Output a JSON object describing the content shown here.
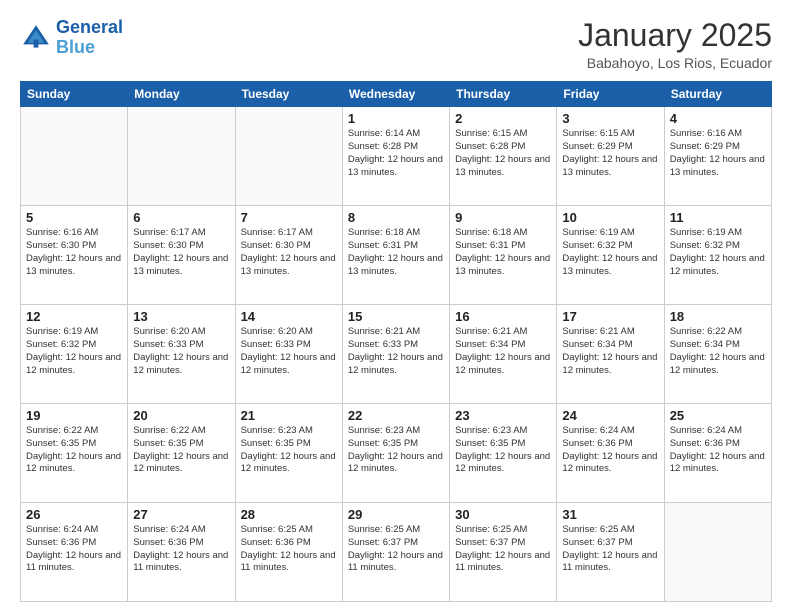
{
  "logo": {
    "line1": "General",
    "line2": "Blue"
  },
  "title": "January 2025",
  "subtitle": "Babahoyo, Los Rios, Ecuador",
  "days_of_week": [
    "Sunday",
    "Monday",
    "Tuesday",
    "Wednesday",
    "Thursday",
    "Friday",
    "Saturday"
  ],
  "weeks": [
    [
      {
        "day": "",
        "info": ""
      },
      {
        "day": "",
        "info": ""
      },
      {
        "day": "",
        "info": ""
      },
      {
        "day": "1",
        "info": "Sunrise: 6:14 AM\nSunset: 6:28 PM\nDaylight: 12 hours and 13 minutes."
      },
      {
        "day": "2",
        "info": "Sunrise: 6:15 AM\nSunset: 6:28 PM\nDaylight: 12 hours and 13 minutes."
      },
      {
        "day": "3",
        "info": "Sunrise: 6:15 AM\nSunset: 6:29 PM\nDaylight: 12 hours and 13 minutes."
      },
      {
        "day": "4",
        "info": "Sunrise: 6:16 AM\nSunset: 6:29 PM\nDaylight: 12 hours and 13 minutes."
      }
    ],
    [
      {
        "day": "5",
        "info": "Sunrise: 6:16 AM\nSunset: 6:30 PM\nDaylight: 12 hours and 13 minutes."
      },
      {
        "day": "6",
        "info": "Sunrise: 6:17 AM\nSunset: 6:30 PM\nDaylight: 12 hours and 13 minutes."
      },
      {
        "day": "7",
        "info": "Sunrise: 6:17 AM\nSunset: 6:30 PM\nDaylight: 12 hours and 13 minutes."
      },
      {
        "day": "8",
        "info": "Sunrise: 6:18 AM\nSunset: 6:31 PM\nDaylight: 12 hours and 13 minutes."
      },
      {
        "day": "9",
        "info": "Sunrise: 6:18 AM\nSunset: 6:31 PM\nDaylight: 12 hours and 13 minutes."
      },
      {
        "day": "10",
        "info": "Sunrise: 6:19 AM\nSunset: 6:32 PM\nDaylight: 12 hours and 13 minutes."
      },
      {
        "day": "11",
        "info": "Sunrise: 6:19 AM\nSunset: 6:32 PM\nDaylight: 12 hours and 12 minutes."
      }
    ],
    [
      {
        "day": "12",
        "info": "Sunrise: 6:19 AM\nSunset: 6:32 PM\nDaylight: 12 hours and 12 minutes."
      },
      {
        "day": "13",
        "info": "Sunrise: 6:20 AM\nSunset: 6:33 PM\nDaylight: 12 hours and 12 minutes."
      },
      {
        "day": "14",
        "info": "Sunrise: 6:20 AM\nSunset: 6:33 PM\nDaylight: 12 hours and 12 minutes."
      },
      {
        "day": "15",
        "info": "Sunrise: 6:21 AM\nSunset: 6:33 PM\nDaylight: 12 hours and 12 minutes."
      },
      {
        "day": "16",
        "info": "Sunrise: 6:21 AM\nSunset: 6:34 PM\nDaylight: 12 hours and 12 minutes."
      },
      {
        "day": "17",
        "info": "Sunrise: 6:21 AM\nSunset: 6:34 PM\nDaylight: 12 hours and 12 minutes."
      },
      {
        "day": "18",
        "info": "Sunrise: 6:22 AM\nSunset: 6:34 PM\nDaylight: 12 hours and 12 minutes."
      }
    ],
    [
      {
        "day": "19",
        "info": "Sunrise: 6:22 AM\nSunset: 6:35 PM\nDaylight: 12 hours and 12 minutes."
      },
      {
        "day": "20",
        "info": "Sunrise: 6:22 AM\nSunset: 6:35 PM\nDaylight: 12 hours and 12 minutes."
      },
      {
        "day": "21",
        "info": "Sunrise: 6:23 AM\nSunset: 6:35 PM\nDaylight: 12 hours and 12 minutes."
      },
      {
        "day": "22",
        "info": "Sunrise: 6:23 AM\nSunset: 6:35 PM\nDaylight: 12 hours and 12 minutes."
      },
      {
        "day": "23",
        "info": "Sunrise: 6:23 AM\nSunset: 6:35 PM\nDaylight: 12 hours and 12 minutes."
      },
      {
        "day": "24",
        "info": "Sunrise: 6:24 AM\nSunset: 6:36 PM\nDaylight: 12 hours and 12 minutes."
      },
      {
        "day": "25",
        "info": "Sunrise: 6:24 AM\nSunset: 6:36 PM\nDaylight: 12 hours and 12 minutes."
      }
    ],
    [
      {
        "day": "26",
        "info": "Sunrise: 6:24 AM\nSunset: 6:36 PM\nDaylight: 12 hours and 11 minutes."
      },
      {
        "day": "27",
        "info": "Sunrise: 6:24 AM\nSunset: 6:36 PM\nDaylight: 12 hours and 11 minutes."
      },
      {
        "day": "28",
        "info": "Sunrise: 6:25 AM\nSunset: 6:36 PM\nDaylight: 12 hours and 11 minutes."
      },
      {
        "day": "29",
        "info": "Sunrise: 6:25 AM\nSunset: 6:37 PM\nDaylight: 12 hours and 11 minutes."
      },
      {
        "day": "30",
        "info": "Sunrise: 6:25 AM\nSunset: 6:37 PM\nDaylight: 12 hours and 11 minutes."
      },
      {
        "day": "31",
        "info": "Sunrise: 6:25 AM\nSunset: 6:37 PM\nDaylight: 12 hours and 11 minutes."
      },
      {
        "day": "",
        "info": ""
      }
    ]
  ]
}
